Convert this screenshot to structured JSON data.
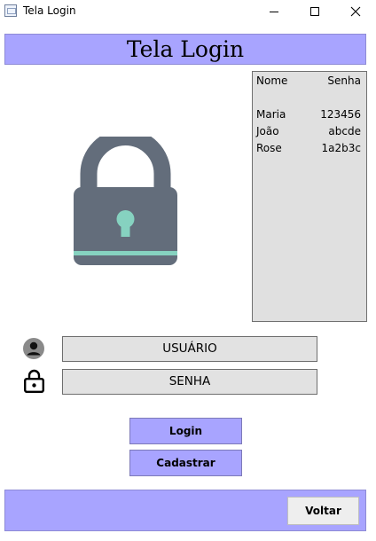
{
  "window": {
    "title": "Tela Login",
    "icon": "app-window-icon",
    "controls": [
      "minimize-icon",
      "maximize-icon",
      "close-icon"
    ]
  },
  "header": {
    "title": "Tela Login",
    "background": "#A8A4FF"
  },
  "illustration": {
    "icon": "lock-icon",
    "body_color": "#636D7B",
    "accent_color": "#86D2C0"
  },
  "users_table": {
    "headers": [
      "Nome",
      "Senha"
    ],
    "rows": [
      [
        "Maria",
        "123456"
      ],
      [
        "João",
        "abcde"
      ],
      [
        "Rose",
        "1a2b3c"
      ]
    ],
    "background": "#E0E0E0"
  },
  "form": {
    "username": {
      "icon": "user-icon",
      "value": "USUÁRIO"
    },
    "password": {
      "icon": "padlock-icon",
      "value": "SENHA"
    }
  },
  "buttons": {
    "login": "Login",
    "cadastrar": "Cadastrar",
    "voltar": "Voltar"
  },
  "footer": {
    "background": "#A8A4FF"
  }
}
